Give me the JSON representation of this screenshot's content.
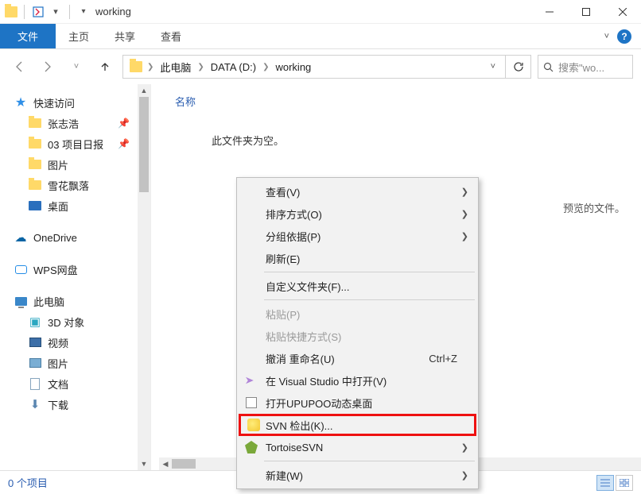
{
  "titlebar": {
    "title": "working"
  },
  "ribbon": {
    "file": "文件",
    "tabs": [
      "主页",
      "共享",
      "查看"
    ]
  },
  "breadcrumb": {
    "segments": [
      "此电脑",
      "DATA (D:)",
      "working"
    ]
  },
  "search": {
    "placeholder": "搜索\"wo..."
  },
  "sidebar": {
    "quick_access": "快速访问",
    "quick_items": [
      {
        "label": "张志浩",
        "icon": "folder",
        "pinned": true
      },
      {
        "label": "03 项目日报",
        "icon": "folder",
        "pinned": true
      },
      {
        "label": "图片",
        "icon": "folder",
        "pinned": false
      },
      {
        "label": "雪花飘落",
        "icon": "folder",
        "pinned": false
      },
      {
        "label": "桌面",
        "icon": "desktop",
        "pinned": false
      }
    ],
    "onedrive": "OneDrive",
    "wps": "WPS网盘",
    "this_pc": "此电脑",
    "pc_items": [
      {
        "label": "3D 对象",
        "icon": "cube"
      },
      {
        "label": "视频",
        "icon": "video"
      },
      {
        "label": "图片",
        "icon": "pic"
      },
      {
        "label": "文档",
        "icon": "doc"
      },
      {
        "label": "下载",
        "icon": "down"
      }
    ]
  },
  "content": {
    "column_header": "名称",
    "empty_text": "此文件夹为空。",
    "preview_text": "预览的文件。"
  },
  "statusbar": {
    "count_label": "0 个项目"
  },
  "context_menu": {
    "view": "查看(V)",
    "sort": "排序方式(O)",
    "group": "分组依据(P)",
    "refresh": "刷新(E)",
    "customize": "自定义文件夹(F)...",
    "paste": "粘贴(P)",
    "paste_shortcut": "粘贴快捷方式(S)",
    "undo_rename": "撤消 重命名(U)",
    "undo_shortcut": "Ctrl+Z",
    "open_vs": "在 Visual Studio 中打开(V)",
    "open_upupoo": "打开UPUPOO动态桌面",
    "svn_checkout": "SVN 检出(K)...",
    "tortoise_svn": "TortoiseSVN",
    "new": "新建(W)"
  }
}
